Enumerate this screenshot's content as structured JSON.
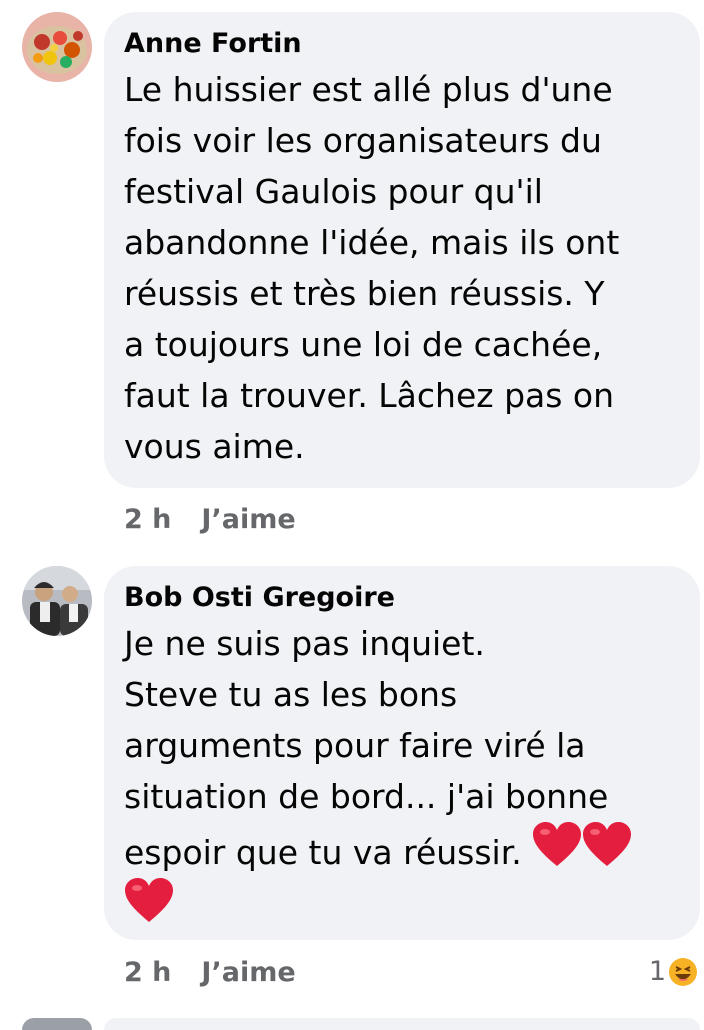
{
  "comments": [
    {
      "author": "Anne Fortin",
      "text": "Le huissier est allé plus d'une\nfois voir les organisateurs du\nfestival Gaulois pour qu'il\nabandonne l'idée, mais ils ont\nréussis et très bien réussis.  Y\na toujours une loi de cachée,\nfaut la trouver.  Lâchez pas on\nvous aime.",
      "time": "2 h",
      "like_label": "J’aime"
    },
    {
      "author": "Bob Osti Gregoire",
      "text": "Je ne suis pas inquiet.\nSteve tu as les bons\narguments pour faire viré la\nsituation de bord... j'ai bonne\nespoir que tu va réussir.",
      "emojis": [
        "red-heart",
        "red-heart",
        "red-heart"
      ],
      "time": "2 h",
      "like_label": "J’aime",
      "reaction_count": "1",
      "reaction_type": "haha"
    }
  ],
  "colors": {
    "bubble": "#f0f2f5",
    "meta_text": "#65676b",
    "text": "#050505",
    "heart": "#e41e3f",
    "haha": "#f7b125"
  }
}
